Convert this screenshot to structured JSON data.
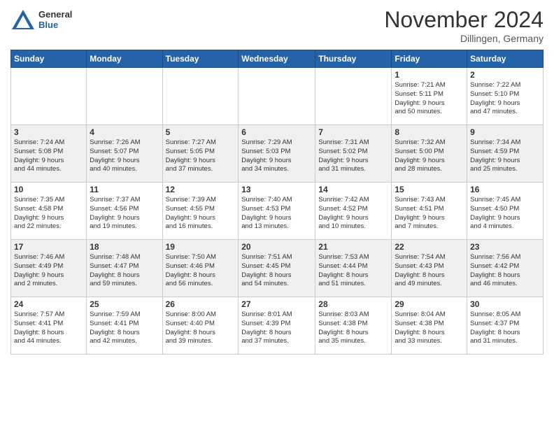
{
  "header": {
    "logo": {
      "general": "General",
      "blue": "Blue"
    },
    "title": "November 2024",
    "location": "Dillingen, Germany"
  },
  "weekdays": [
    "Sunday",
    "Monday",
    "Tuesday",
    "Wednesday",
    "Thursday",
    "Friday",
    "Saturday"
  ],
  "weeks": [
    [
      {
        "day": "",
        "info": ""
      },
      {
        "day": "",
        "info": ""
      },
      {
        "day": "",
        "info": ""
      },
      {
        "day": "",
        "info": ""
      },
      {
        "day": "",
        "info": ""
      },
      {
        "day": "1",
        "info": "Sunrise: 7:21 AM\nSunset: 5:11 PM\nDaylight: 9 hours\nand 50 minutes."
      },
      {
        "day": "2",
        "info": "Sunrise: 7:22 AM\nSunset: 5:10 PM\nDaylight: 9 hours\nand 47 minutes."
      }
    ],
    [
      {
        "day": "3",
        "info": "Sunrise: 7:24 AM\nSunset: 5:08 PM\nDaylight: 9 hours\nand 44 minutes."
      },
      {
        "day": "4",
        "info": "Sunrise: 7:26 AM\nSunset: 5:07 PM\nDaylight: 9 hours\nand 40 minutes."
      },
      {
        "day": "5",
        "info": "Sunrise: 7:27 AM\nSunset: 5:05 PM\nDaylight: 9 hours\nand 37 minutes."
      },
      {
        "day": "6",
        "info": "Sunrise: 7:29 AM\nSunset: 5:03 PM\nDaylight: 9 hours\nand 34 minutes."
      },
      {
        "day": "7",
        "info": "Sunrise: 7:31 AM\nSunset: 5:02 PM\nDaylight: 9 hours\nand 31 minutes."
      },
      {
        "day": "8",
        "info": "Sunrise: 7:32 AM\nSunset: 5:00 PM\nDaylight: 9 hours\nand 28 minutes."
      },
      {
        "day": "9",
        "info": "Sunrise: 7:34 AM\nSunset: 4:59 PM\nDaylight: 9 hours\nand 25 minutes."
      }
    ],
    [
      {
        "day": "10",
        "info": "Sunrise: 7:35 AM\nSunset: 4:58 PM\nDaylight: 9 hours\nand 22 minutes."
      },
      {
        "day": "11",
        "info": "Sunrise: 7:37 AM\nSunset: 4:56 PM\nDaylight: 9 hours\nand 19 minutes."
      },
      {
        "day": "12",
        "info": "Sunrise: 7:39 AM\nSunset: 4:55 PM\nDaylight: 9 hours\nand 16 minutes."
      },
      {
        "day": "13",
        "info": "Sunrise: 7:40 AM\nSunset: 4:53 PM\nDaylight: 9 hours\nand 13 minutes."
      },
      {
        "day": "14",
        "info": "Sunrise: 7:42 AM\nSunset: 4:52 PM\nDaylight: 9 hours\nand 10 minutes."
      },
      {
        "day": "15",
        "info": "Sunrise: 7:43 AM\nSunset: 4:51 PM\nDaylight: 9 hours\nand 7 minutes."
      },
      {
        "day": "16",
        "info": "Sunrise: 7:45 AM\nSunset: 4:50 PM\nDaylight: 9 hours\nand 4 minutes."
      }
    ],
    [
      {
        "day": "17",
        "info": "Sunrise: 7:46 AM\nSunset: 4:49 PM\nDaylight: 9 hours\nand 2 minutes."
      },
      {
        "day": "18",
        "info": "Sunrise: 7:48 AM\nSunset: 4:47 PM\nDaylight: 8 hours\nand 59 minutes."
      },
      {
        "day": "19",
        "info": "Sunrise: 7:50 AM\nSunset: 4:46 PM\nDaylight: 8 hours\nand 56 minutes."
      },
      {
        "day": "20",
        "info": "Sunrise: 7:51 AM\nSunset: 4:45 PM\nDaylight: 8 hours\nand 54 minutes."
      },
      {
        "day": "21",
        "info": "Sunrise: 7:53 AM\nSunset: 4:44 PM\nDaylight: 8 hours\nand 51 minutes."
      },
      {
        "day": "22",
        "info": "Sunrise: 7:54 AM\nSunset: 4:43 PM\nDaylight: 8 hours\nand 49 minutes."
      },
      {
        "day": "23",
        "info": "Sunrise: 7:56 AM\nSunset: 4:42 PM\nDaylight: 8 hours\nand 46 minutes."
      }
    ],
    [
      {
        "day": "24",
        "info": "Sunrise: 7:57 AM\nSunset: 4:41 PM\nDaylight: 8 hours\nand 44 minutes."
      },
      {
        "day": "25",
        "info": "Sunrise: 7:59 AM\nSunset: 4:41 PM\nDaylight: 8 hours\nand 42 minutes."
      },
      {
        "day": "26",
        "info": "Sunrise: 8:00 AM\nSunset: 4:40 PM\nDaylight: 8 hours\nand 39 minutes."
      },
      {
        "day": "27",
        "info": "Sunrise: 8:01 AM\nSunset: 4:39 PM\nDaylight: 8 hours\nand 37 minutes."
      },
      {
        "day": "28",
        "info": "Sunrise: 8:03 AM\nSunset: 4:38 PM\nDaylight: 8 hours\nand 35 minutes."
      },
      {
        "day": "29",
        "info": "Sunrise: 8:04 AM\nSunset: 4:38 PM\nDaylight: 8 hours\nand 33 minutes."
      },
      {
        "day": "30",
        "info": "Sunrise: 8:05 AM\nSunset: 4:37 PM\nDaylight: 8 hours\nand 31 minutes."
      }
    ]
  ]
}
